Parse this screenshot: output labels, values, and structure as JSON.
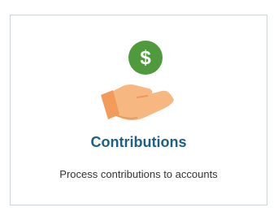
{
  "card": {
    "title": "Contributions",
    "description": "Process contributions to accounts",
    "icon": "hand-holding-dollar-icon",
    "colors": {
      "title": "#1f5f86",
      "coin": "#4f9a3d",
      "hand": "#f7b780",
      "border": "#cfd4d9"
    },
    "coin_symbol": "$"
  }
}
